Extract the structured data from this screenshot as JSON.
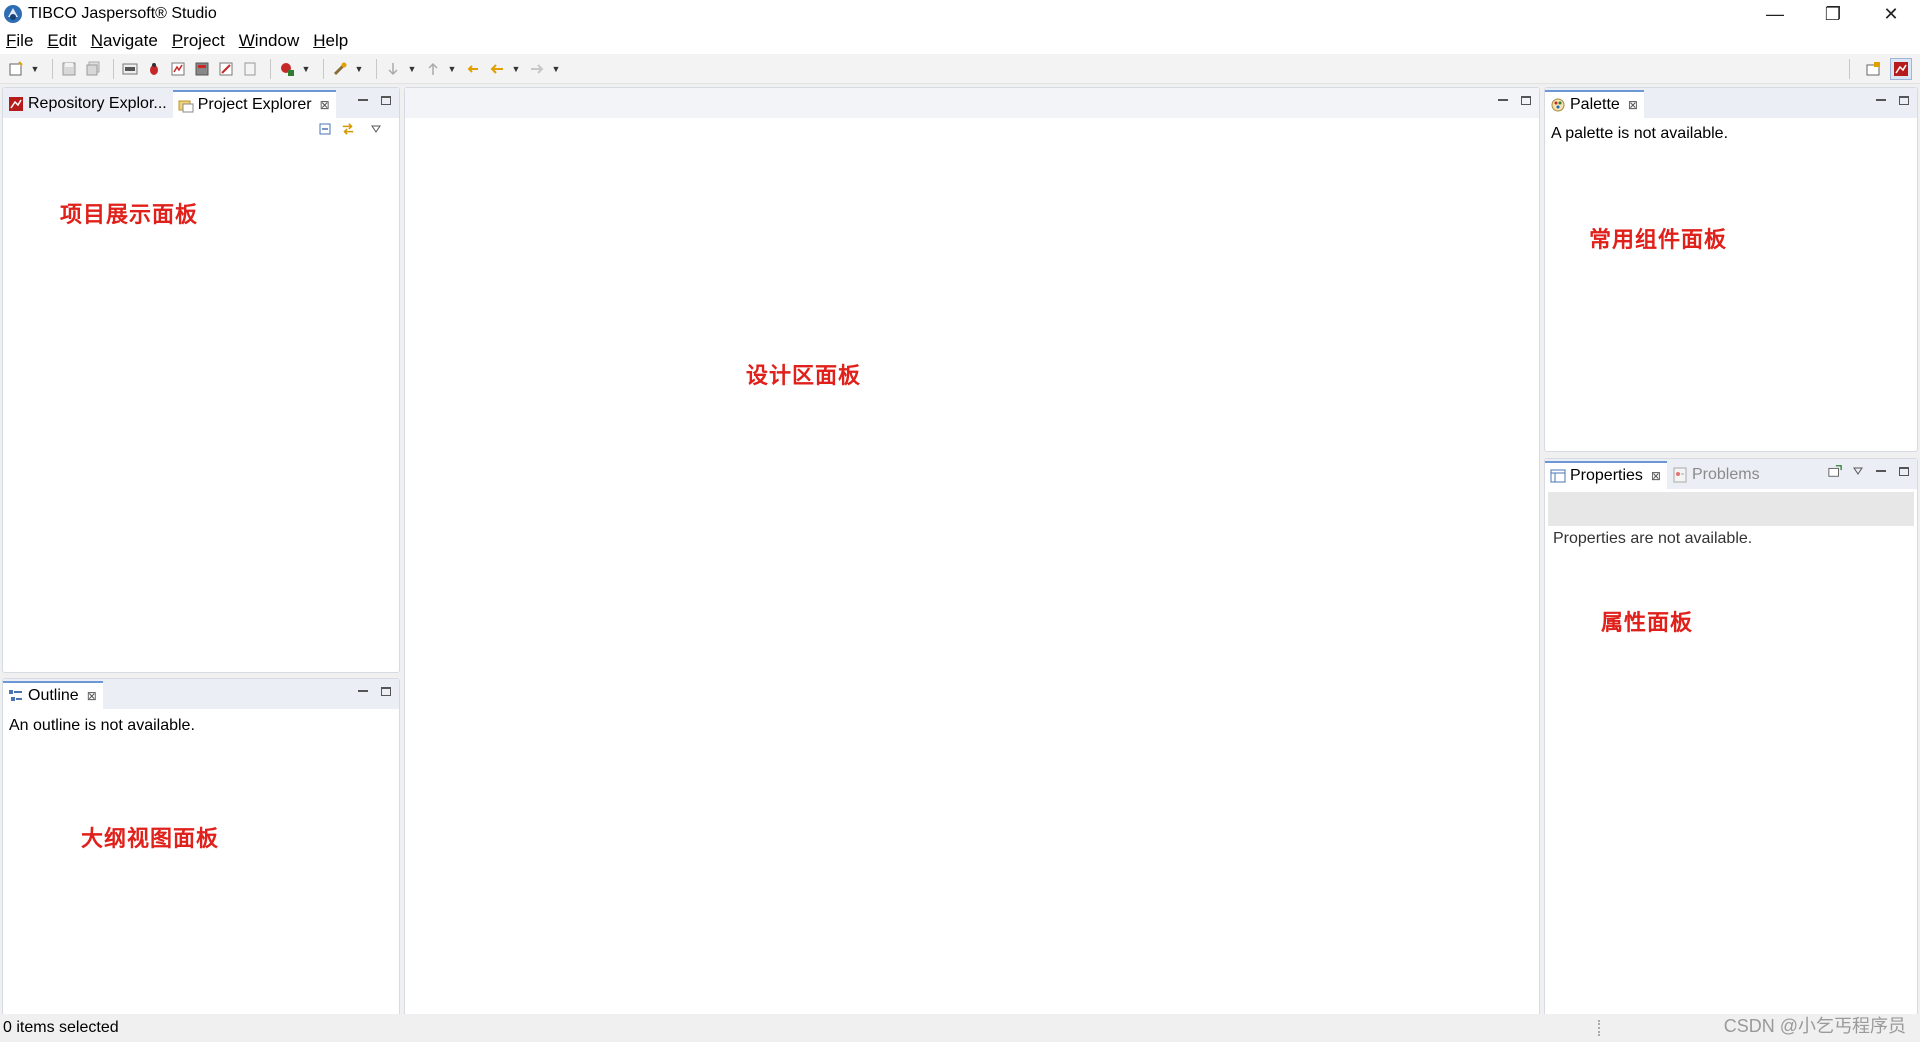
{
  "window": {
    "title": "TIBCO Jaspersoft® Studio",
    "controls": {
      "minimize": "—",
      "restore": "❐",
      "close": "✕"
    }
  },
  "menubar": {
    "items": [
      {
        "mnemonic": "F",
        "rest": "ile"
      },
      {
        "mnemonic": "E",
        "rest": "dit"
      },
      {
        "mnemonic": "N",
        "rest": "avigate"
      },
      {
        "mnemonic": "P",
        "rest": "roject"
      },
      {
        "mnemonic": "W",
        "rest": "indow"
      },
      {
        "mnemonic": "H",
        "rest": "elp"
      }
    ]
  },
  "left_top_panel": {
    "tabs": [
      {
        "label": "Repository Explor..."
      },
      {
        "label": "Project Explorer",
        "close": "⊠"
      }
    ]
  },
  "outline_panel": {
    "tab_label": "Outline",
    "close": "⊠",
    "message": "An outline is not available."
  },
  "palette_panel": {
    "tab_label": "Palette",
    "close": "⊠",
    "message": "A palette is not available."
  },
  "properties_panel": {
    "tabs": [
      {
        "label": "Properties",
        "close": "⊠"
      },
      {
        "label": "Problems"
      }
    ],
    "message": "Properties are not available."
  },
  "annotations": {
    "project": "项目展示面板",
    "outline": "大纲视图面板",
    "design": "设计区面板",
    "palette": "常用组件面板",
    "properties": "属性面板"
  },
  "statusbar": {
    "text": "0 items selected"
  },
  "watermark": "CSDN @小乞丐程序员",
  "colors": {
    "annotation": "#e0201b",
    "active_tab_border": "#6b98d4",
    "tabbar_bg": "#ebeff5"
  }
}
